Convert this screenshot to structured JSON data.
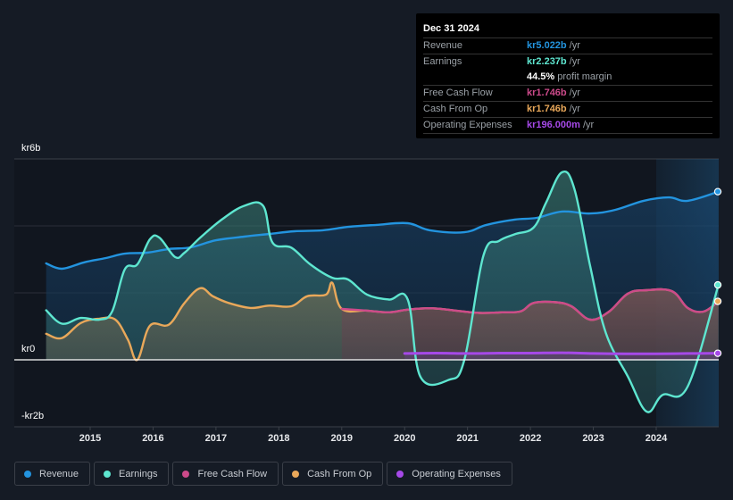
{
  "tooltip": {
    "date": "Dec 31 2024",
    "rows": [
      {
        "label": "Revenue",
        "value": "kr5.022b",
        "unit": "/yr",
        "color": "#2394df"
      },
      {
        "label": "Earnings",
        "value": "kr2.237b",
        "unit": "/yr",
        "color": "#5ee6d0"
      },
      {
        "label": "",
        "value": "44.5%",
        "unit": "profit margin",
        "color": "#ffffff"
      },
      {
        "label": "Free Cash Flow",
        "value": "kr1.746b",
        "unit": "/yr",
        "color": "#cc4a8a"
      },
      {
        "label": "Cash From Op",
        "value": "kr1.746b",
        "unit": "/yr",
        "color": "#e9a85a"
      },
      {
        "label": "Operating Expenses",
        "value": "kr196.000m",
        "unit": "/yr",
        "color": "#a649e8"
      }
    ]
  },
  "legend": [
    {
      "label": "Revenue",
      "color": "#2394df"
    },
    {
      "label": "Earnings",
      "color": "#5ee6d0"
    },
    {
      "label": "Free Cash Flow",
      "color": "#cc4a8a"
    },
    {
      "label": "Cash From Op",
      "color": "#e9a85a"
    },
    {
      "label": "Operating Expenses",
      "color": "#a649e8"
    }
  ],
  "chart_data": {
    "type": "area",
    "title": "",
    "xlabel": "",
    "ylabel": "",
    "y_tick_labels": [
      "kr6b",
      "kr0",
      "-kr2b"
    ],
    "y_ticks": [
      6,
      4,
      2,
      0,
      -2
    ],
    "ylim": [
      -2,
      6
    ],
    "y_unit": "billion kr",
    "xlim": [
      2014.3,
      2025.0
    ],
    "x_tick_labels": [
      "2015",
      "2016",
      "2017",
      "2018",
      "2019",
      "2020",
      "2021",
      "2022",
      "2023",
      "2024"
    ],
    "x_ticks": [
      2015,
      2016,
      2017,
      2018,
      2019,
      2020,
      2021,
      2022,
      2023,
      2024
    ],
    "highlight_from": 2024.0,
    "grid": true,
    "legend_position": "bottom",
    "series": [
      {
        "name": "Revenue",
        "color": "#2394df",
        "x": [
          2014.3,
          2014.55,
          2014.9,
          2015.25,
          2015.55,
          2015.9,
          2016.25,
          2016.6,
          2017.0,
          2017.45,
          2017.85,
          2018.25,
          2018.7,
          2019.1,
          2019.55,
          2020.05,
          2020.4,
          2020.95,
          2021.3,
          2021.75,
          2022.1,
          2022.5,
          2022.95,
          2023.35,
          2023.8,
          2024.2,
          2024.5,
          2024.99
        ],
        "values": [
          2.88,
          2.72,
          2.91,
          3.04,
          3.17,
          3.2,
          3.31,
          3.36,
          3.57,
          3.68,
          3.76,
          3.84,
          3.87,
          3.97,
          4.03,
          4.08,
          3.87,
          3.81,
          4.03,
          4.19,
          4.24,
          4.43,
          4.37,
          4.48,
          4.75,
          4.85,
          4.75,
          5.022
        ]
      },
      {
        "name": "Earnings",
        "color": "#5ee6d0",
        "x": [
          2014.3,
          2014.55,
          2014.85,
          2015.15,
          2015.35,
          2015.55,
          2015.75,
          2015.95,
          2016.1,
          2016.35,
          2016.5,
          2016.75,
          2017.1,
          2017.45,
          2017.75,
          2017.9,
          2018.2,
          2018.5,
          2018.85,
          2019.1,
          2019.4,
          2019.75,
          2020.05,
          2020.25,
          2020.7,
          2020.95,
          2021.25,
          2021.5,
          2021.75,
          2022.05,
          2022.25,
          2022.5,
          2022.7,
          2022.95,
          2023.2,
          2023.55,
          2023.85,
          2024.1,
          2024.5,
          2024.99
        ],
        "values": [
          1.48,
          1.08,
          1.25,
          1.2,
          1.45,
          2.7,
          2.85,
          3.6,
          3.65,
          3.07,
          3.2,
          3.65,
          4.2,
          4.6,
          4.6,
          3.5,
          3.35,
          2.85,
          2.45,
          2.4,
          1.95,
          1.8,
          1.8,
          -0.5,
          -0.6,
          0.0,
          3.1,
          3.55,
          3.75,
          3.95,
          4.7,
          5.6,
          5.1,
          2.8,
          0.8,
          -0.5,
          -1.55,
          -1.05,
          -0.8,
          2.237
        ]
      },
      {
        "name": "Free Cash Flow",
        "color": "#cc4a8a",
        "x": [
          2019.0,
          2019.4,
          2019.75,
          2020.05,
          2020.45,
          2020.9,
          2021.2,
          2021.55,
          2021.85,
          2022.05,
          2022.4,
          2022.65,
          2022.95,
          2023.25,
          2023.55,
          2023.85,
          2024.25,
          2024.5,
          2024.75,
          2024.99
        ],
        "values": [
          1.52,
          1.47,
          1.42,
          1.5,
          1.54,
          1.45,
          1.4,
          1.42,
          1.45,
          1.7,
          1.72,
          1.6,
          1.2,
          1.44,
          1.98,
          2.08,
          2.05,
          1.55,
          1.44,
          1.746
        ]
      },
      {
        "name": "Cash From Op",
        "color": "#e9a85a",
        "x": [
          2014.3,
          2014.55,
          2014.85,
          2015.15,
          2015.4,
          2015.6,
          2015.75,
          2015.95,
          2016.25,
          2016.5,
          2016.75,
          2016.95,
          2017.2,
          2017.55,
          2017.85,
          2018.2,
          2018.45,
          2018.75,
          2018.85,
          2019.0,
          2019.4,
          2019.75,
          2020.05,
          2020.45,
          2020.9,
          2021.2,
          2021.55,
          2021.85,
          2022.05,
          2022.4,
          2022.65,
          2022.95,
          2023.25,
          2023.55,
          2023.85,
          2024.25,
          2024.5,
          2024.75,
          2024.99
        ],
        "values": [
          0.78,
          0.65,
          1.1,
          1.23,
          1.2,
          0.6,
          0.0,
          1.02,
          1.05,
          1.7,
          2.14,
          1.9,
          1.7,
          1.55,
          1.62,
          1.6,
          1.9,
          1.95,
          2.3,
          1.52,
          1.47,
          1.42,
          1.5,
          1.54,
          1.45,
          1.4,
          1.42,
          1.45,
          1.7,
          1.72,
          1.6,
          1.2,
          1.44,
          1.98,
          2.08,
          2.05,
          1.55,
          1.44,
          1.746
        ]
      },
      {
        "name": "Operating Expenses",
        "color": "#a649e8",
        "x": [
          2020.0,
          2020.5,
          2021.0,
          2021.5,
          2022.0,
          2022.5,
          2023.0,
          2023.5,
          2024.0,
          2024.5,
          2024.99
        ],
        "values": [
          0.19,
          0.2,
          0.19,
          0.2,
          0.2,
          0.21,
          0.19,
          0.18,
          0.18,
          0.19,
          0.196
        ]
      }
    ]
  }
}
